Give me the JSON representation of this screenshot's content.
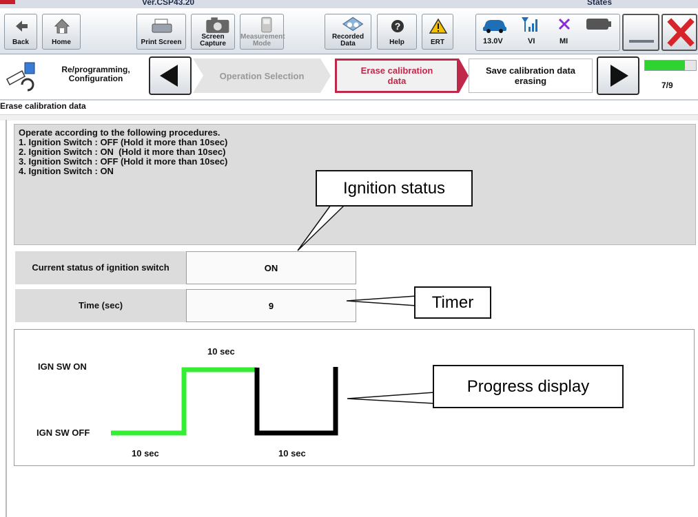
{
  "titlebar": {
    "version": "Ver.CSP43.20",
    "right_label": "States"
  },
  "toolbar": {
    "back": "Back",
    "home": "Home",
    "print_screen": "Print Screen",
    "screen_capture_line1": "Screen",
    "screen_capture_line2": "Capture",
    "measurement_line1": "Measurement",
    "measurement_line2": "Mode",
    "recorded_line1": "Recorded",
    "recorded_line2": "Data",
    "help": "Help",
    "ert": "ERT",
    "voltage": "13.0V",
    "vi": "VI",
    "mi": "MI"
  },
  "nav": {
    "category_line1": "Re/programming,",
    "category_line2": "Configuration",
    "step_prev": "Operation Selection",
    "step_current_line1": "Erase calibration",
    "step_current_line2": "data",
    "step_next_line1": "Save calibration data",
    "step_next_line2": "erasing",
    "page_indicator": "7/9",
    "progress_fraction": 0.78
  },
  "section_title": "Erase calibration data",
  "instructions": {
    "intro": "Operate according to the following procedures.",
    "steps": [
      "1. Ignition Switch : OFF (Hold it more than 10sec)",
      "2. Ignition Switch : ON  (Hold it more than 10sec)",
      "3. Ignition Switch : OFF (Hold it more than 10sec)",
      "4. Ignition Switch : ON"
    ]
  },
  "status_table": {
    "ignition_label": "Current status of ignition switch",
    "ignition_value": "ON",
    "time_label": "Time (sec)",
    "time_value": "9"
  },
  "progress_display": {
    "ign_on_label": "IGN SW ON",
    "ign_off_label": "IGN SW OFF",
    "top_duration": "10 sec",
    "bottom_duration_1": "10 sec",
    "bottom_duration_2": "10 sec",
    "done_color": "#33ee33",
    "pending_color": "#000000"
  },
  "callouts": {
    "ignition_status": "Ignition status",
    "timer": "Timer",
    "progress_display": "Progress display"
  },
  "colors": {
    "current_step_border": "#c0284a",
    "current_step_text": "#c0284a",
    "progress_green": "#2fd32f",
    "close_red": "#d6242a"
  }
}
